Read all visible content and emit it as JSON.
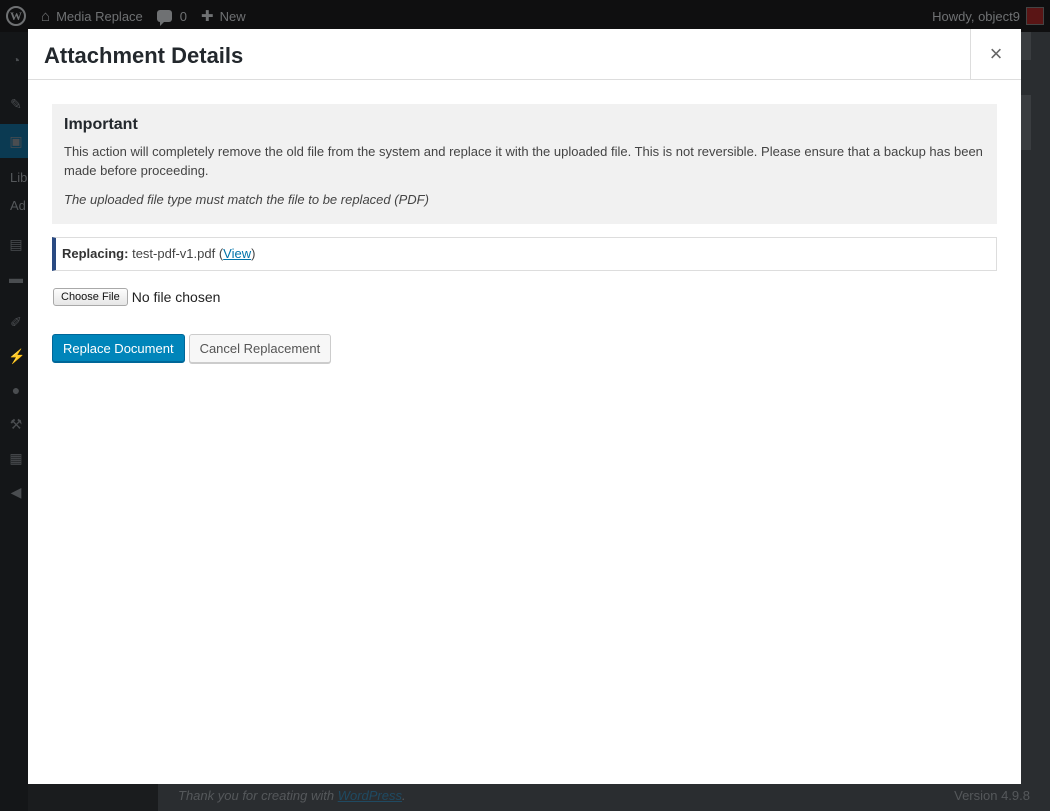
{
  "adminbar": {
    "site_name": "Media Replace",
    "comments_count": "0",
    "new_label": "New",
    "greeting": "Howdy, object9"
  },
  "sidemenu": {
    "library_label": "Lib",
    "add_new_label": "Ad"
  },
  "footer": {
    "thanks_prefix": "Thank you for creating with",
    "thanks_link": "WordPress",
    "thanks_suffix": ".",
    "version": "Version 4.9.8"
  },
  "modal": {
    "title": "Attachment Details",
    "close_label": "×",
    "notice": {
      "heading": "Important",
      "text": "This action will completely remove the old file from the system and replace it with the uploaded file. This is not reversible. Please ensure that a backup has been made before proceeding.",
      "note": "The uploaded file type must match the file to be replaced (PDF)"
    },
    "replacing": {
      "label": "Replacing:",
      "filename": "test-pdf-v1.pdf",
      "open_paren": "(",
      "view_link": "View",
      "close_paren": ")"
    },
    "file_input": {
      "button_label": "Choose File",
      "status": "No file chosen"
    },
    "buttons": {
      "replace_label": "Replace Document",
      "cancel_label": "Cancel Replacement"
    }
  },
  "colors": {
    "primary_button": "#0085ba",
    "replacing_accent": "#2a4a82",
    "link": "#0073aa"
  }
}
